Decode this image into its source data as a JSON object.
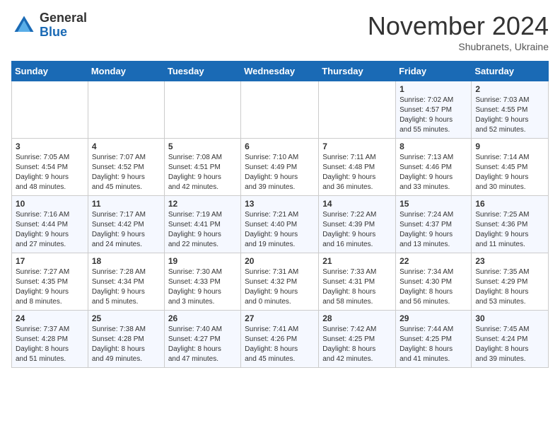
{
  "logo": {
    "general": "General",
    "blue": "Blue"
  },
  "title": "November 2024",
  "subtitle": "Shubranets, Ukraine",
  "days_header": [
    "Sunday",
    "Monday",
    "Tuesday",
    "Wednesday",
    "Thursday",
    "Friday",
    "Saturday"
  ],
  "weeks": [
    [
      {
        "day": "",
        "info": ""
      },
      {
        "day": "",
        "info": ""
      },
      {
        "day": "",
        "info": ""
      },
      {
        "day": "",
        "info": ""
      },
      {
        "day": "",
        "info": ""
      },
      {
        "day": "1",
        "info": "Sunrise: 7:02 AM\nSunset: 4:57 PM\nDaylight: 9 hours\nand 55 minutes."
      },
      {
        "day": "2",
        "info": "Sunrise: 7:03 AM\nSunset: 4:55 PM\nDaylight: 9 hours\nand 52 minutes."
      }
    ],
    [
      {
        "day": "3",
        "info": "Sunrise: 7:05 AM\nSunset: 4:54 PM\nDaylight: 9 hours\nand 48 minutes."
      },
      {
        "day": "4",
        "info": "Sunrise: 7:07 AM\nSunset: 4:52 PM\nDaylight: 9 hours\nand 45 minutes."
      },
      {
        "day": "5",
        "info": "Sunrise: 7:08 AM\nSunset: 4:51 PM\nDaylight: 9 hours\nand 42 minutes."
      },
      {
        "day": "6",
        "info": "Sunrise: 7:10 AM\nSunset: 4:49 PM\nDaylight: 9 hours\nand 39 minutes."
      },
      {
        "day": "7",
        "info": "Sunrise: 7:11 AM\nSunset: 4:48 PM\nDaylight: 9 hours\nand 36 minutes."
      },
      {
        "day": "8",
        "info": "Sunrise: 7:13 AM\nSunset: 4:46 PM\nDaylight: 9 hours\nand 33 minutes."
      },
      {
        "day": "9",
        "info": "Sunrise: 7:14 AM\nSunset: 4:45 PM\nDaylight: 9 hours\nand 30 minutes."
      }
    ],
    [
      {
        "day": "10",
        "info": "Sunrise: 7:16 AM\nSunset: 4:44 PM\nDaylight: 9 hours\nand 27 minutes."
      },
      {
        "day": "11",
        "info": "Sunrise: 7:17 AM\nSunset: 4:42 PM\nDaylight: 9 hours\nand 24 minutes."
      },
      {
        "day": "12",
        "info": "Sunrise: 7:19 AM\nSunset: 4:41 PM\nDaylight: 9 hours\nand 22 minutes."
      },
      {
        "day": "13",
        "info": "Sunrise: 7:21 AM\nSunset: 4:40 PM\nDaylight: 9 hours\nand 19 minutes."
      },
      {
        "day": "14",
        "info": "Sunrise: 7:22 AM\nSunset: 4:39 PM\nDaylight: 9 hours\nand 16 minutes."
      },
      {
        "day": "15",
        "info": "Sunrise: 7:24 AM\nSunset: 4:37 PM\nDaylight: 9 hours\nand 13 minutes."
      },
      {
        "day": "16",
        "info": "Sunrise: 7:25 AM\nSunset: 4:36 PM\nDaylight: 9 hours\nand 11 minutes."
      }
    ],
    [
      {
        "day": "17",
        "info": "Sunrise: 7:27 AM\nSunset: 4:35 PM\nDaylight: 9 hours\nand 8 minutes."
      },
      {
        "day": "18",
        "info": "Sunrise: 7:28 AM\nSunset: 4:34 PM\nDaylight: 9 hours\nand 5 minutes."
      },
      {
        "day": "19",
        "info": "Sunrise: 7:30 AM\nSunset: 4:33 PM\nDaylight: 9 hours\nand 3 minutes."
      },
      {
        "day": "20",
        "info": "Sunrise: 7:31 AM\nSunset: 4:32 PM\nDaylight: 9 hours\nand 0 minutes."
      },
      {
        "day": "21",
        "info": "Sunrise: 7:33 AM\nSunset: 4:31 PM\nDaylight: 8 hours\nand 58 minutes."
      },
      {
        "day": "22",
        "info": "Sunrise: 7:34 AM\nSunset: 4:30 PM\nDaylight: 8 hours\nand 56 minutes."
      },
      {
        "day": "23",
        "info": "Sunrise: 7:35 AM\nSunset: 4:29 PM\nDaylight: 8 hours\nand 53 minutes."
      }
    ],
    [
      {
        "day": "24",
        "info": "Sunrise: 7:37 AM\nSunset: 4:28 PM\nDaylight: 8 hours\nand 51 minutes."
      },
      {
        "day": "25",
        "info": "Sunrise: 7:38 AM\nSunset: 4:28 PM\nDaylight: 8 hours\nand 49 minutes."
      },
      {
        "day": "26",
        "info": "Sunrise: 7:40 AM\nSunset: 4:27 PM\nDaylight: 8 hours\nand 47 minutes."
      },
      {
        "day": "27",
        "info": "Sunrise: 7:41 AM\nSunset: 4:26 PM\nDaylight: 8 hours\nand 45 minutes."
      },
      {
        "day": "28",
        "info": "Sunrise: 7:42 AM\nSunset: 4:25 PM\nDaylight: 8 hours\nand 42 minutes."
      },
      {
        "day": "29",
        "info": "Sunrise: 7:44 AM\nSunset: 4:25 PM\nDaylight: 8 hours\nand 41 minutes."
      },
      {
        "day": "30",
        "info": "Sunrise: 7:45 AM\nSunset: 4:24 PM\nDaylight: 8 hours\nand 39 minutes."
      }
    ]
  ]
}
